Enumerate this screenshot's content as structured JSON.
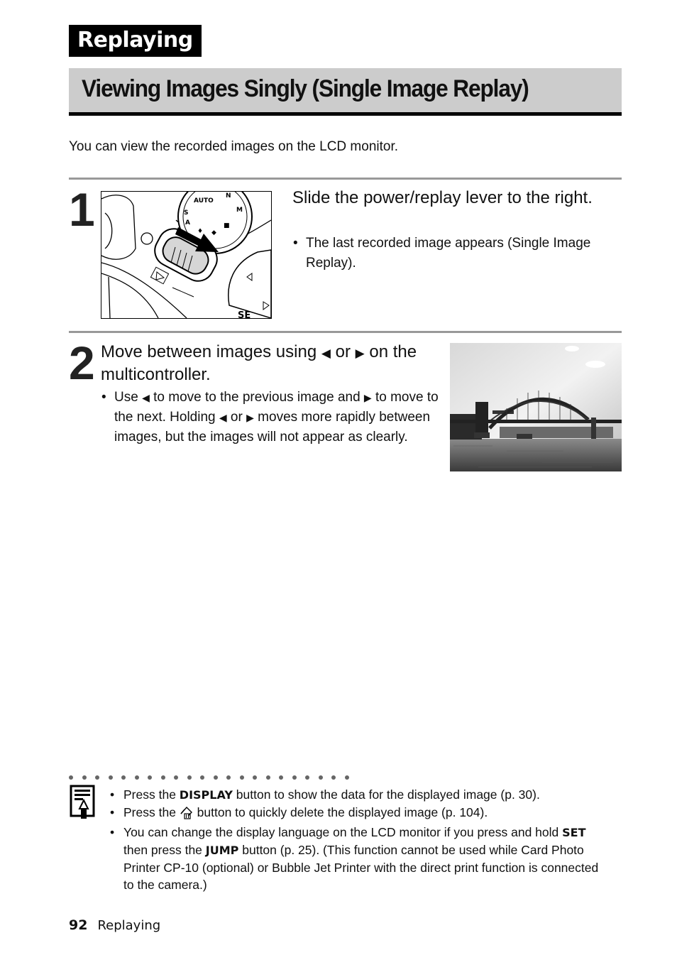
{
  "section_tab": "Replaying",
  "page_title": "Viewing Images Singly (Single Image Replay)",
  "intro": "You can view the recorded images on the LCD monitor.",
  "steps": [
    {
      "number": "1",
      "title": "Slide the power/replay lever to the right.",
      "bullet_marker": "•",
      "bullets": [
        "The last recorded image appears (Single Image Replay)."
      ],
      "figure": "camera-power-replay-lever-illustration"
    },
    {
      "number": "2",
      "title_parts": [
        "Move between images using ",
        "◀",
        " or ",
        "▶",
        " on the multicontroller."
      ],
      "bullet_marker": "•",
      "bullet_parts": [
        "Use ",
        "◀",
        " to move to the previous image and ",
        "▶",
        " to move to the next. Holding ",
        "◀",
        " or ",
        "▶",
        " moves more rapidly between images, but the images will not appear as clearly."
      ],
      "figure": "harbour-bridge-sample-photo"
    }
  ],
  "notes": {
    "icon": "memo-pencil-icon",
    "bullet_marker": "•",
    "items": [
      {
        "pre": "Press the ",
        "key": "DISPLAY",
        "post": " button to show the data for the displayed image (p. 30)."
      },
      {
        "pre": "Press the ",
        "key_icon": "erase-trash-icon",
        "post": " button to quickly delete the displayed image (p. 104)."
      },
      {
        "pre": "You can change the display language on the LCD monitor if you press and hold ",
        "key": "SET",
        "mid": " then press the ",
        "key2": "JUMP",
        "post": " button (p. 25). (This function cannot be used while Card Photo Printer CP-10 (optional) or Bubble Jet Printer with the direct print function is connected to the camera.)"
      }
    ]
  },
  "footer": {
    "page_number": "92",
    "section": "Replaying"
  }
}
